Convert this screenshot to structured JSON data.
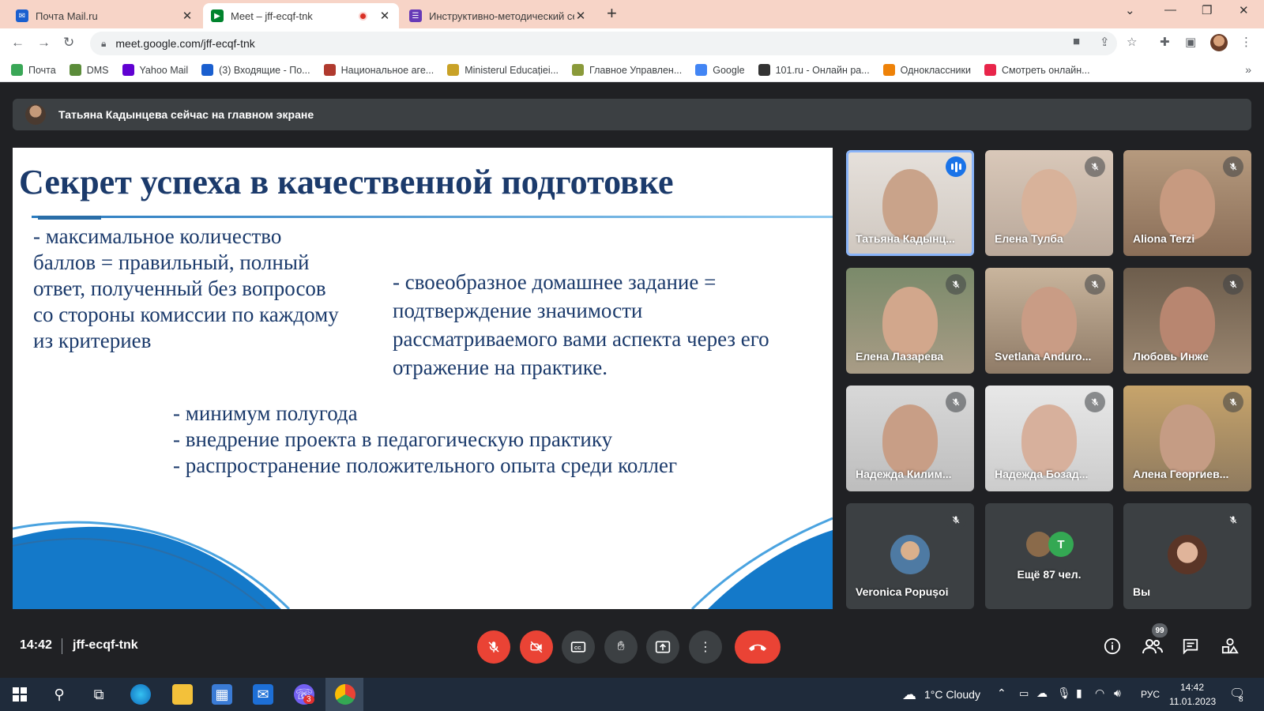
{
  "browser": {
    "tabs": [
      {
        "title": "Почта Mail.ru",
        "icon": "mail-ru-icon"
      },
      {
        "title": "Meet – jff-ecqf-tnk",
        "icon": "google-meet-icon"
      },
      {
        "title": "Инструктивно-методический се",
        "icon": "forms-icon"
      }
    ],
    "url": "meet.google.com/jff-ecqf-tnk",
    "bookmarks": [
      {
        "label": "Почта",
        "color": "#3aa757"
      },
      {
        "label": "DMS",
        "color": "#5b8c3a"
      },
      {
        "label": "Yahoo Mail",
        "color": "#6001d2"
      },
      {
        "label": "(3) Входящие - По...",
        "color": "#1a5fcf"
      },
      {
        "label": "Национальное аге...",
        "color": "#b03a2e"
      },
      {
        "label": "Ministerul Educației...",
        "color": "#c9a227"
      },
      {
        "label": "Главное Управлен...",
        "color": "#8a9a3a"
      },
      {
        "label": "Google",
        "color": "#4285f4"
      },
      {
        "label": "101.ru - Онлайн ра...",
        "color": "#333333"
      },
      {
        "label": "Одноклассники",
        "color": "#ee8208"
      },
      {
        "label": "Смотреть онлайн...",
        "color": "#e8254a"
      }
    ]
  },
  "meet": {
    "banner": "Татьяна Кадынцева сейчас на главном экране",
    "slide": {
      "title": "Секрет успеха в качественной подготовке",
      "left_text": "- максимальное количество баллов = правильный, полный ответ, полученный без вопросов со стороны комиссии по каждому из критериев",
      "right_text": "- своеобразное домашнее задание = подтверждение значимости рассматриваемого вами аспекта через его отражение на практике.",
      "bottom_lines": [
        "- минимум полугода",
        "- внедрение проекта в педагогическую практику",
        "- распространение положительного опыта среди коллег"
      ]
    },
    "participants": [
      {
        "name": "Татьяна Кадынц...",
        "speaking": true
      },
      {
        "name": "Елена Тулба",
        "muted": true
      },
      {
        "name": "Aliona Terzi",
        "muted": true
      },
      {
        "name": "Елена Лазарева",
        "muted": true
      },
      {
        "name": "Svetlana Anduro...",
        "muted": true
      },
      {
        "name": "Любовь Инже",
        "muted": true
      },
      {
        "name": "Надежда Килим...",
        "muted": true
      },
      {
        "name": "Надежда Бозад...",
        "muted": true
      },
      {
        "name": "Алена Георгиев...",
        "muted": true
      },
      {
        "name": "Veronica Popușoi",
        "muted": true
      },
      {
        "name": "Ещё 87 чел.",
        "extra_initial": "T"
      },
      {
        "name": "Вы",
        "muted": true
      }
    ],
    "footer": {
      "time": "14:42",
      "meeting_code": "jff-ecqf-tnk",
      "people_badge": "99"
    }
  },
  "taskbar": {
    "weather": "1°C  Cloudy",
    "lang": "РУС",
    "time": "14:42",
    "date": "11.01.2023",
    "notification_count": "8",
    "viber_badge": "3"
  }
}
